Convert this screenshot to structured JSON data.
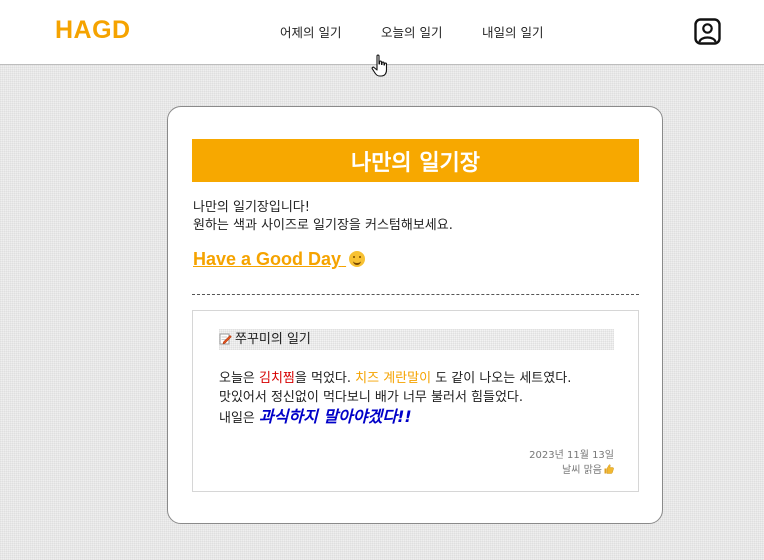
{
  "header": {
    "logo": "HAGD",
    "nav": [
      {
        "label": "어제의 일기"
      },
      {
        "label": "오늘의 일기"
      },
      {
        "label": "내일의 일기"
      }
    ],
    "profile_icon": "user-profile-icon",
    "cursor_icon": "hand-pointer-icon"
  },
  "card": {
    "title": "나만의 일기장",
    "intro_line1": "나만의 일기장입니다!",
    "intro_line2": "원하는 색과 사이즈로 일기장을 커스텀해보세요.",
    "have_good_day": "Have a Good Day",
    "have_good_day_icon": "smile-icon"
  },
  "diary": {
    "icon": "memo-icon",
    "title": "쭈꾸미의 일기",
    "body": {
      "p1_a": "오늘은 ",
      "p1_red": "김치찜",
      "p1_b": "을 먹었다. ",
      "p1_orange": "치즈 계란말이",
      "p1_c": " 도 같이 나오는 세트였다.",
      "p2": "맛있어서 정신없이 먹다보니 배가 너무 불러서 힘들었다.",
      "p3_a": "내일은 ",
      "p3_emph": "과식하지 말아야겠다!!"
    },
    "date": "2023년 11월 13일",
    "weather": "날씨 맑음",
    "weather_icon": "thumbs-up-icon"
  },
  "colors": {
    "accent": "#f5a300",
    "title_bar": "#f7a800",
    "red_text": "#d60000",
    "emphasis_text": "#0000c8"
  }
}
